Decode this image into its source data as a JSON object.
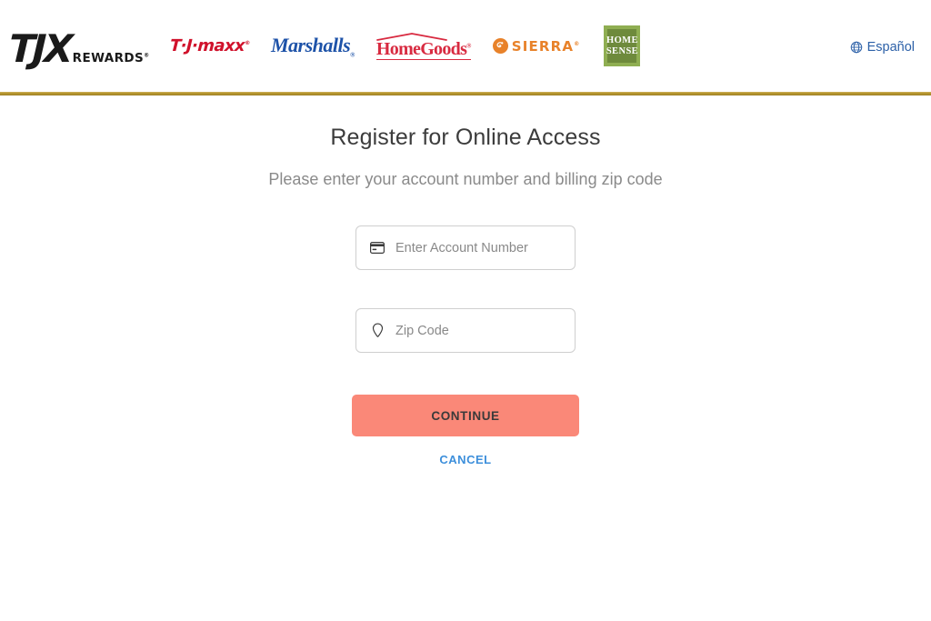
{
  "header": {
    "logos": [
      {
        "name": "tjx-rewards",
        "mark": "TJX",
        "wordmark": "REWARDS",
        "trademark": "®"
      },
      {
        "name": "tj-maxx",
        "text": "T·J·mаxx",
        "trademark": "®"
      },
      {
        "name": "marshalls",
        "text": "Marshalls",
        "trademark": "®"
      },
      {
        "name": "homegoods",
        "text": "HomeGoods",
        "trademark": "®"
      },
      {
        "name": "sierra",
        "text": "SIERRA",
        "trademark": "®"
      },
      {
        "name": "homesense",
        "line1": "HOME",
        "line2": "SENSE"
      }
    ],
    "language_link": {
      "label": "Español",
      "icon": "globe-icon",
      "color": "#2D61A8"
    },
    "rule_color": "#B4942F"
  },
  "main": {
    "title": "Register for Online Access",
    "subtitle": "Please enter your account number and billing zip code",
    "fields": [
      {
        "name": "account-number",
        "icon": "credit-card-icon",
        "value": "",
        "placeholder": "Enter Account Number"
      },
      {
        "name": "zip-code",
        "icon": "location-pin-icon",
        "value": "",
        "placeholder": "Zip Code"
      }
    ],
    "continue_label": "CONTINUE",
    "cancel_label": "CANCEL",
    "continue_color": "#FA8878",
    "cancel_color": "#3D8FDB"
  }
}
